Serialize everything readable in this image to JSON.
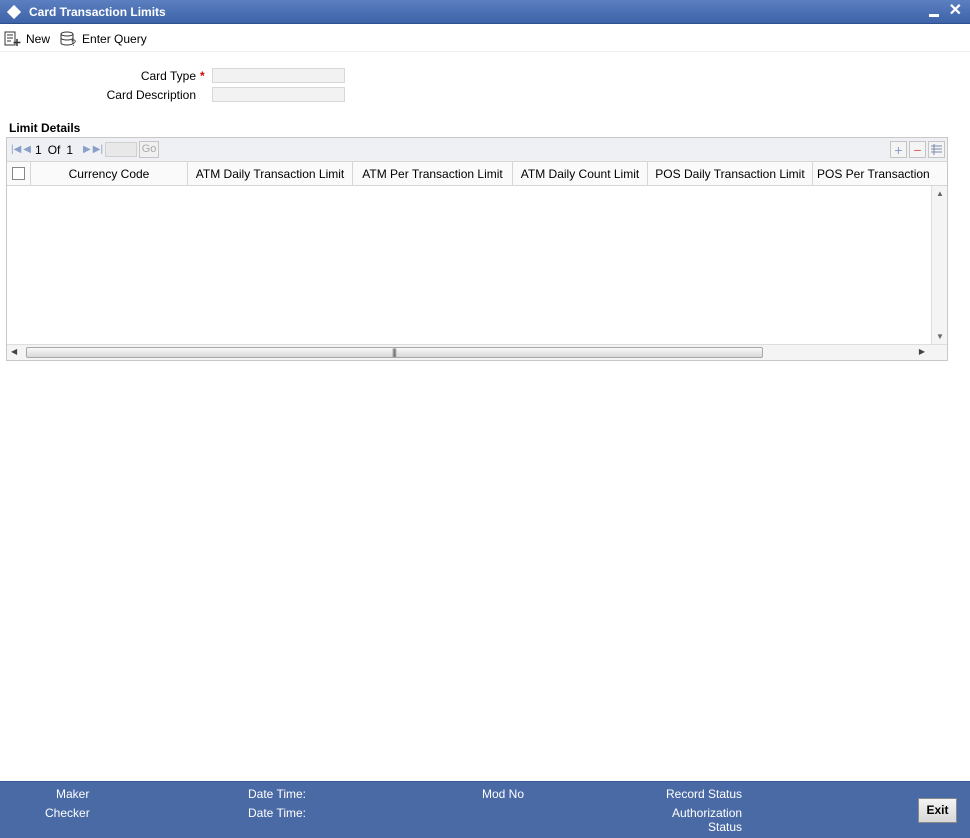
{
  "window": {
    "title": "Card Transaction Limits"
  },
  "toolbar": {
    "new_label": "New",
    "enter_query_label": "Enter Query"
  },
  "form": {
    "card_type_label": "Card Type",
    "card_type_required": "*",
    "card_description_label": "Card Description"
  },
  "limit_details": {
    "title": "Limit Details",
    "pager": {
      "current": "1",
      "of_label": "Of",
      "total": "1",
      "go_label": "Go"
    },
    "columns": [
      "Currency Code",
      "ATM Daily Transaction Limit",
      "ATM Per Transaction Limit",
      "ATM Daily Count Limit",
      "POS Daily Transaction Limit",
      "POS Per Transaction"
    ]
  },
  "footer": {
    "maker_label": "Maker",
    "checker_label": "Checker",
    "date_time_label_1": "Date Time:",
    "date_time_label_2": "Date Time:",
    "mod_no_label": "Mod No",
    "record_status_label": "Record Status",
    "authorization_label": "Authorization",
    "status_label": "Status",
    "exit_label": "Exit"
  }
}
